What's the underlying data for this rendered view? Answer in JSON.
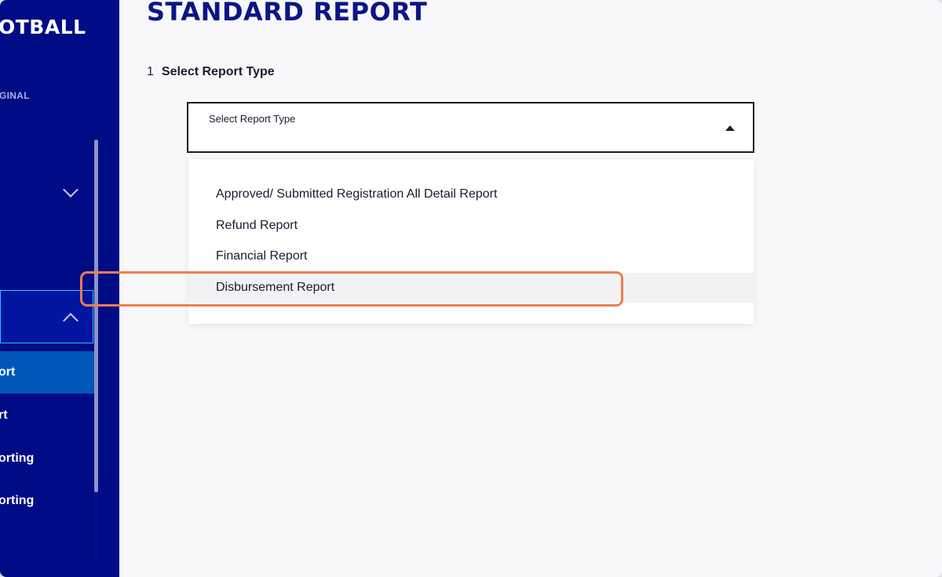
{
  "sidebar": {
    "brand": "OTBALL",
    "brand_sub": "GINAL",
    "items": [
      {
        "label": "ort"
      },
      {
        "label": "rt"
      },
      {
        "label": "orting"
      },
      {
        "label": "orting"
      }
    ]
  },
  "main": {
    "title": "STANDARD REPORT",
    "step": {
      "number": "1",
      "label": "Select Report Type"
    },
    "select": {
      "label": "Select Report Type"
    },
    "options": [
      {
        "label": "Approved/ Submitted Registration All Detail Report"
      },
      {
        "label": "Refund Report"
      },
      {
        "label": "Financial Report"
      },
      {
        "label": "Disbursement Report"
      }
    ]
  }
}
